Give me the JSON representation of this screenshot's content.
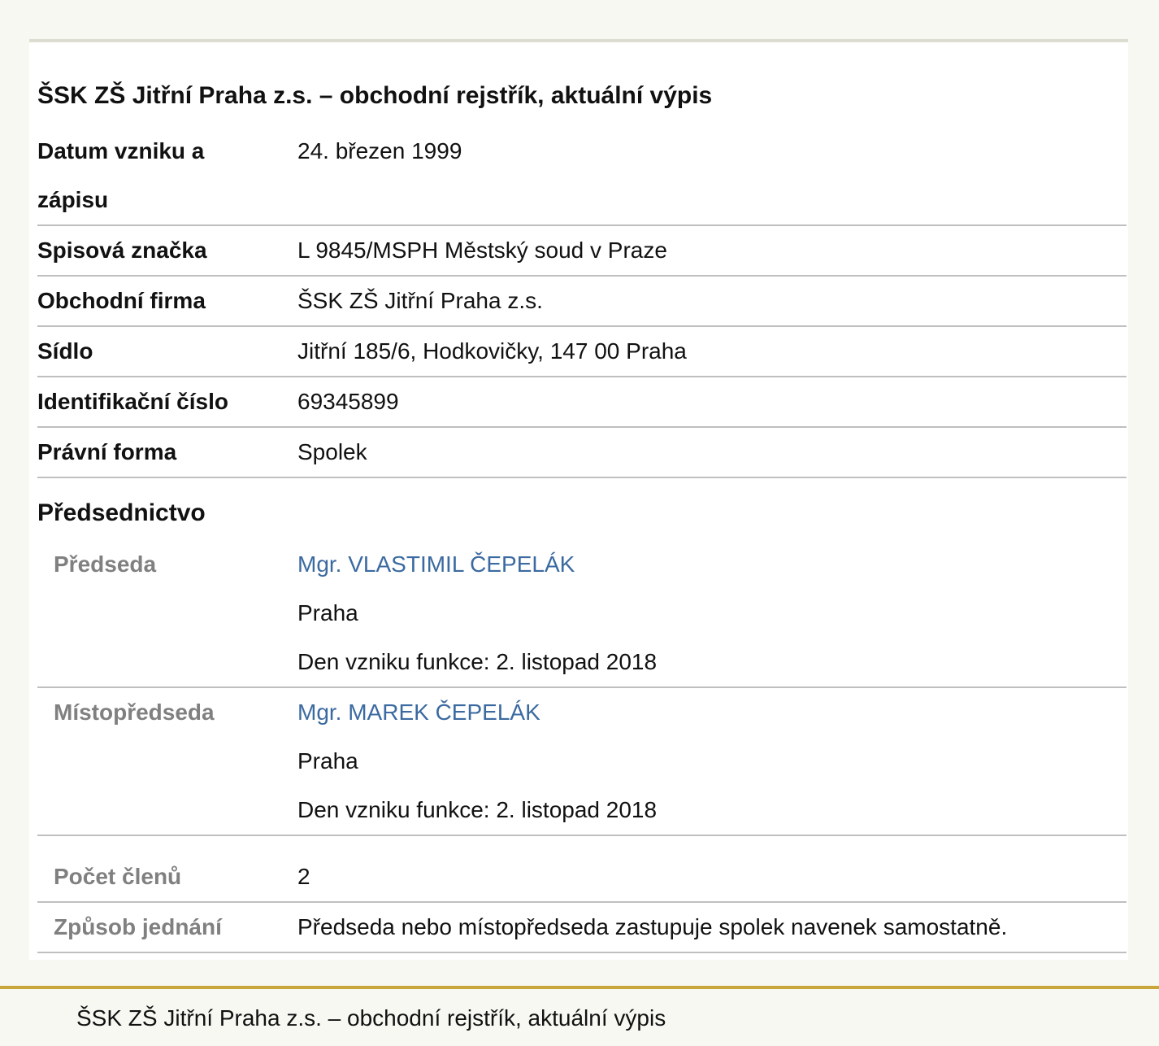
{
  "document": {
    "title": "ŠSK ZŠ Jitřní Praha z.s. – obchodní rejstřík, aktuální výpis",
    "rows": [
      {
        "label_line1": "Datum vzniku a",
        "label_line2": "zápisu",
        "value": "24. březen 1999"
      },
      {
        "label": "Spisová značka",
        "value": "L 9845/MSPH Městský soud v Praze"
      },
      {
        "label": "Obchodní firma",
        "value": "ŠSK ZŠ Jitřní Praha z.s."
      },
      {
        "label": "Sídlo",
        "value": "Jitřní 185/6, Hodkovičky, 147 00 Praha"
      },
      {
        "label": "Identifikační číslo",
        "value": "69345899"
      },
      {
        "label": "Právní forma",
        "value": "Spolek"
      }
    ],
    "section_title": "Předsednictvo",
    "members": [
      {
        "role": "Předseda",
        "name": "Mgr. VLASTIMIL ČEPELÁK",
        "city": "Praha",
        "since": "Den vzniku funkce: 2. listopad 2018"
      },
      {
        "role": "Místopředseda",
        "name": "Mgr. MAREK ČEPELÁK",
        "city": "Praha",
        "since": "Den vzniku funkce: 2. listopad 2018"
      }
    ],
    "extra_rows": [
      {
        "label": "Počet členů",
        "value": "2"
      },
      {
        "label": "Způsob jednání",
        "value": "Předseda nebo místopředseda zastupuje spolek navenek samostatně."
      }
    ]
  },
  "footer": {
    "text": "ŠSK ZŠ Jitřní Praha z.s. – obchodní rejstřík, aktuální výpis"
  },
  "colors": {
    "link": "#3b6aa0",
    "sublabel": "#808080",
    "footer_accent": "#c9a63a"
  }
}
